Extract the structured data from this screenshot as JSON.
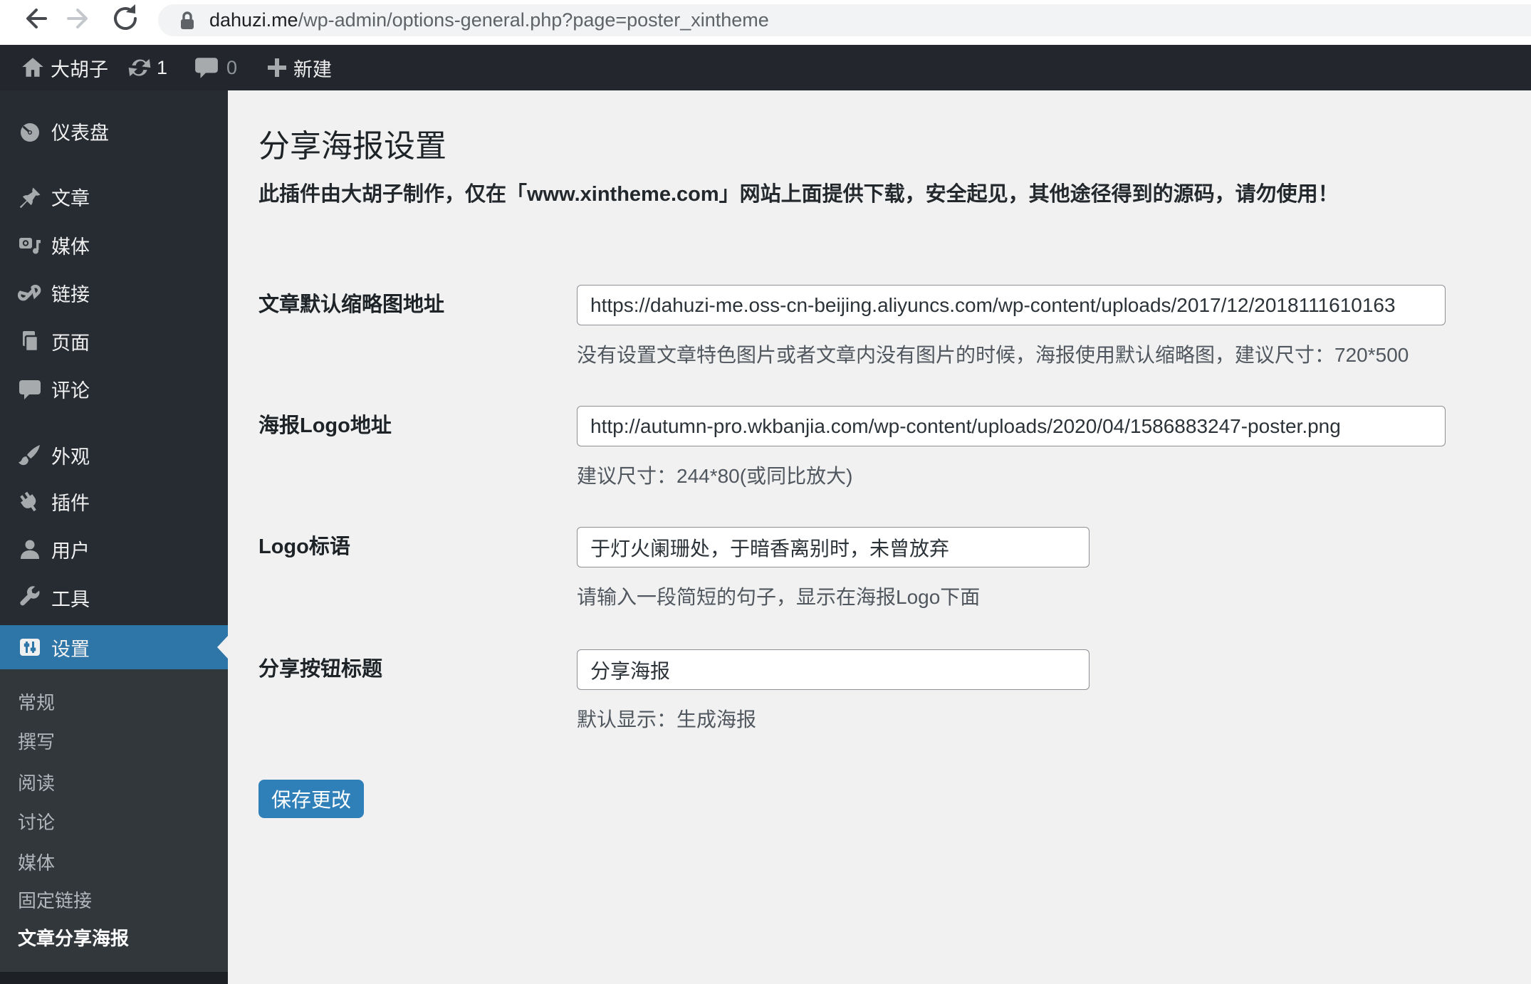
{
  "browser": {
    "url_domain": "dahuzi.me",
    "url_path": "/wp-admin/options-general.php?page=poster_xintheme"
  },
  "admin_bar": {
    "site_name": "大胡子",
    "update_count": "1",
    "comment_count": "0",
    "new_label": "新建"
  },
  "sidebar": {
    "items": [
      {
        "label": "仪表盘",
        "icon": "dashboard-icon"
      },
      {
        "label": "文章",
        "icon": "posts-pin-icon"
      },
      {
        "label": "媒体",
        "icon": "media-icon"
      },
      {
        "label": "链接",
        "icon": "links-chain-icon"
      },
      {
        "label": "页面",
        "icon": "pages-icon"
      },
      {
        "label": "评论",
        "icon": "comments-icon"
      },
      {
        "label": "外观",
        "icon": "appearance-brush-icon"
      },
      {
        "label": "插件",
        "icon": "plugins-plug-icon"
      },
      {
        "label": "用户",
        "icon": "users-icon"
      },
      {
        "label": "工具",
        "icon": "tools-wrench-icon"
      },
      {
        "label": "设置",
        "icon": "settings-sliders-icon",
        "active": true
      }
    ],
    "submenu": [
      "常规",
      "撰写",
      "阅读",
      "讨论",
      "媒体",
      "固定链接",
      "文章分享海报"
    ]
  },
  "main": {
    "title": "分享海报设置",
    "description": "此插件由大胡子制作，仅在「www.xintheme.com」网站上面提供下载，安全起见，其他途径得到的源码，请勿使用！",
    "fields": [
      {
        "label": "文章默认缩略图地址",
        "value": "https://dahuzi-me.oss-cn-beijing.aliyuncs.com/wp-content/uploads/2017/12/2018111610163",
        "help": "没有设置文章特色图片或者文章内没有图片的时候，海报使用默认缩略图，建议尺寸：720*500"
      },
      {
        "label": "海报Logo地址",
        "value": "http://autumn-pro.wkbanjia.com/wp-content/uploads/2020/04/1586883247-poster.png",
        "help": "建议尺寸：244*80(或同比放大)"
      },
      {
        "label": "Logo标语",
        "value": "于灯火阑珊处，于暗香离别时，未曾放弃",
        "help": "请输入一段简短的句子，显示在海报Logo下面"
      },
      {
        "label": "分享按钮标题",
        "value": "分享海报",
        "help": "默认显示：生成海报"
      }
    ],
    "save_label": "保存更改"
  },
  "colors": {
    "accent_menu": "#2e76a8",
    "button": "#2f80b8",
    "admin_bar_bg": "#23272d",
    "sidebar_bg": "#272c33"
  }
}
